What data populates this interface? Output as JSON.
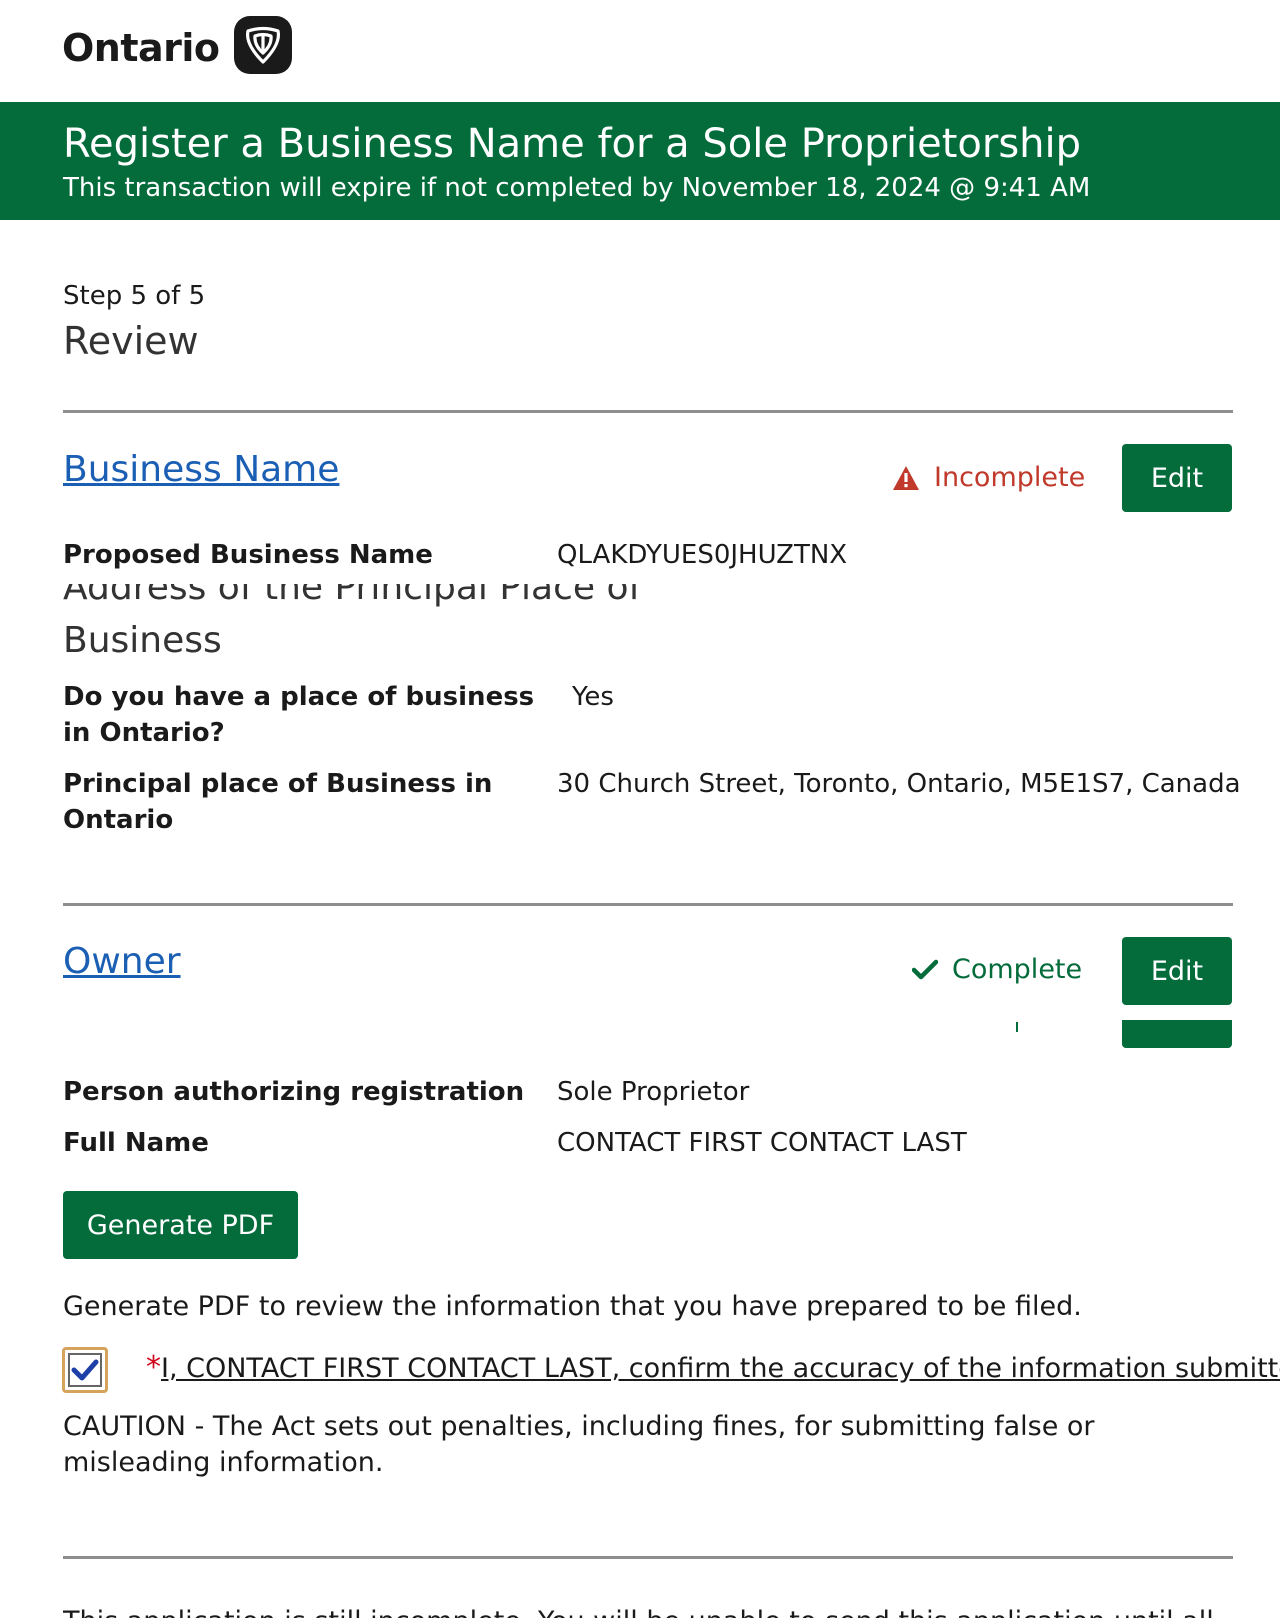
{
  "header": {
    "logo_text": "Ontario"
  },
  "banner": {
    "title": "Register a Business Name for a Sole Proprietorship",
    "subtitle": "This transaction will expire if not completed by November 18, 2024 @ 9:41 AM"
  },
  "step": {
    "counter": "Step 5 of 5",
    "title": "Review"
  },
  "business_section": {
    "heading": "Business Name",
    "status": "Incomplete",
    "status_color": "#c0392b",
    "edit_label": "Edit",
    "proposed_label": "Proposed Business Name",
    "proposed_value": "QLAKDYUES0JHUZTNX",
    "address_heading_partial": "Address of the Principal Place of",
    "address_heading_line2": "Business",
    "place_q_label": "Do you have a place of business in Ontario?",
    "place_q_value": "Yes",
    "principal_label": "Principal place of Business in Ontario",
    "principal_value": "30 Church Street, Toronto, Ontario, M5E1S7, Canada"
  },
  "owner_section": {
    "heading": "Owner",
    "status": "Complete",
    "status_color": "#046b3b",
    "edit_label": "Edit",
    "authorizing_label": "Person authorizing registration",
    "authorizing_value": "Sole Proprietor",
    "fullname_label": "Full Name",
    "fullname_value": "CONTACT FIRST CONTACT LAST"
  },
  "pdf": {
    "button_label": "Generate PDF",
    "help_text": "Generate PDF to review the information that you have prepared to be filed."
  },
  "confirmation": {
    "checked": true,
    "required_mark": "*",
    "text": "I, CONTACT FIRST CONTACT LAST, confirm the accuracy of the information submitted.",
    "caution": "CAUTION - The Act sets out penalties, including fines, for submitting false or misleading information."
  },
  "footer": {
    "partial_text": "This application is still incomplete. You will be unable to send this application until all"
  },
  "colors": {
    "brand_green": "#046b3b",
    "link_blue": "#1a5fb4",
    "divider": "#8e8e8e",
    "checkbox_focus": "#d4a45c",
    "check_blue": "#1e3fa8"
  }
}
